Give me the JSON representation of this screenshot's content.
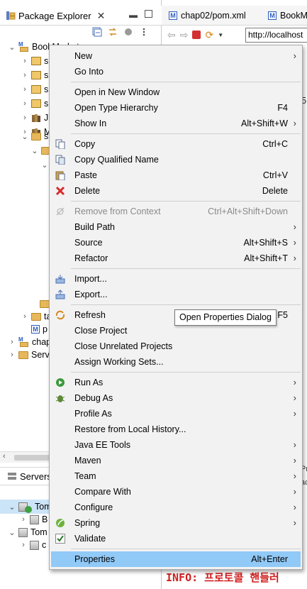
{
  "package_explorer": {
    "tab_title": "Package Explorer",
    "tree": [
      {
        "label": "BookMarket"
      },
      {
        "label": "sr"
      },
      {
        "label": "sr"
      },
      {
        "label": "sr"
      },
      {
        "label": "sr"
      },
      {
        "label": "JR"
      },
      {
        "label": "M"
      },
      {
        "label": "sr"
      },
      {
        "label": ""
      },
      {
        "label": ""
      },
      {
        "label": "ta"
      },
      {
        "label": "p"
      },
      {
        "label": "chap"
      },
      {
        "label": "Serv"
      }
    ]
  },
  "servers": {
    "tab_title": "Servers",
    "rows": [
      {
        "label": "Tom"
      },
      {
        "label": "B"
      },
      {
        "label": "Tom"
      },
      {
        "label": "c"
      }
    ]
  },
  "editor": {
    "tabs": [
      {
        "label": "chap02/pom.xml",
        "icon": "maven-file-icon"
      },
      {
        "label": "BookM",
        "icon": "maven-file-icon"
      }
    ],
    "url": "http://localhost",
    "right_fragments": [
      "Pr",
      "ac",
      "5"
    ],
    "console_info": "INFO: 프로토콜 핸들러"
  },
  "context_menu": {
    "items": [
      {
        "label": "New",
        "shortcut": "",
        "submenu": true
      },
      {
        "label": "Go Into",
        "shortcut": "",
        "submenu": false
      },
      {
        "label": "Open in New Window",
        "shortcut": "",
        "submenu": false
      },
      {
        "label": "Open Type Hierarchy",
        "shortcut": "F4",
        "submenu": false
      },
      {
        "label": "Show In",
        "shortcut": "Alt+Shift+W",
        "submenu": true
      },
      {
        "label": "Copy",
        "shortcut": "Ctrl+C",
        "submenu": false,
        "icon": "copy-icon"
      },
      {
        "label": "Copy Qualified Name",
        "shortcut": "",
        "submenu": false,
        "icon": "copy-qualified-icon"
      },
      {
        "label": "Paste",
        "shortcut": "Ctrl+V",
        "submenu": false,
        "icon": "paste-icon"
      },
      {
        "label": "Delete",
        "shortcut": "Delete",
        "submenu": false,
        "icon": "delete-icon"
      },
      {
        "label": "Remove from Context",
        "shortcut": "Ctrl+Alt+Shift+Down",
        "submenu": false,
        "icon": "remove-context-icon",
        "disabled": true
      },
      {
        "label": "Build Path",
        "shortcut": "",
        "submenu": true
      },
      {
        "label": "Source",
        "shortcut": "Alt+Shift+S",
        "submenu": true
      },
      {
        "label": "Refactor",
        "shortcut": "Alt+Shift+T",
        "submenu": true
      },
      {
        "label": "Import...",
        "shortcut": "",
        "submenu": false,
        "icon": "import-icon"
      },
      {
        "label": "Export...",
        "shortcut": "",
        "submenu": false,
        "icon": "export-icon"
      },
      {
        "label": "Refresh",
        "shortcut": "F5",
        "submenu": false,
        "icon": "refresh-icon"
      },
      {
        "label": "Close Project",
        "shortcut": "",
        "submenu": false
      },
      {
        "label": "Close Unrelated Projects",
        "shortcut": "",
        "submenu": false
      },
      {
        "label": "Assign Working Sets...",
        "shortcut": "",
        "submenu": false
      },
      {
        "label": "Run As",
        "shortcut": "",
        "submenu": true,
        "icon": "run-icon"
      },
      {
        "label": "Debug As",
        "shortcut": "",
        "submenu": true,
        "icon": "debug-icon"
      },
      {
        "label": "Profile As",
        "shortcut": "",
        "submenu": true
      },
      {
        "label": "Restore from Local History...",
        "shortcut": "",
        "submenu": false
      },
      {
        "label": "Java EE Tools",
        "shortcut": "",
        "submenu": true
      },
      {
        "label": "Maven",
        "shortcut": "",
        "submenu": true
      },
      {
        "label": "Team",
        "shortcut": "",
        "submenu": true
      },
      {
        "label": "Compare With",
        "shortcut": "",
        "submenu": true
      },
      {
        "label": "Configure",
        "shortcut": "",
        "submenu": true
      },
      {
        "label": "Spring",
        "shortcut": "",
        "submenu": true,
        "icon": "spring-icon"
      },
      {
        "label": "Validate",
        "shortcut": "",
        "submenu": false,
        "icon": "validate-check-icon"
      },
      {
        "label": "Properties",
        "shortcut": "Alt+Enter",
        "submenu": false,
        "highlighted": true
      }
    ],
    "submenu_arrow": "›"
  },
  "tooltip": {
    "text": "Open Properties Dialog"
  },
  "colors": {
    "highlight": "#91c9f7",
    "menu_bg": "#f2f2f2",
    "console_red": "#d11d1d"
  }
}
